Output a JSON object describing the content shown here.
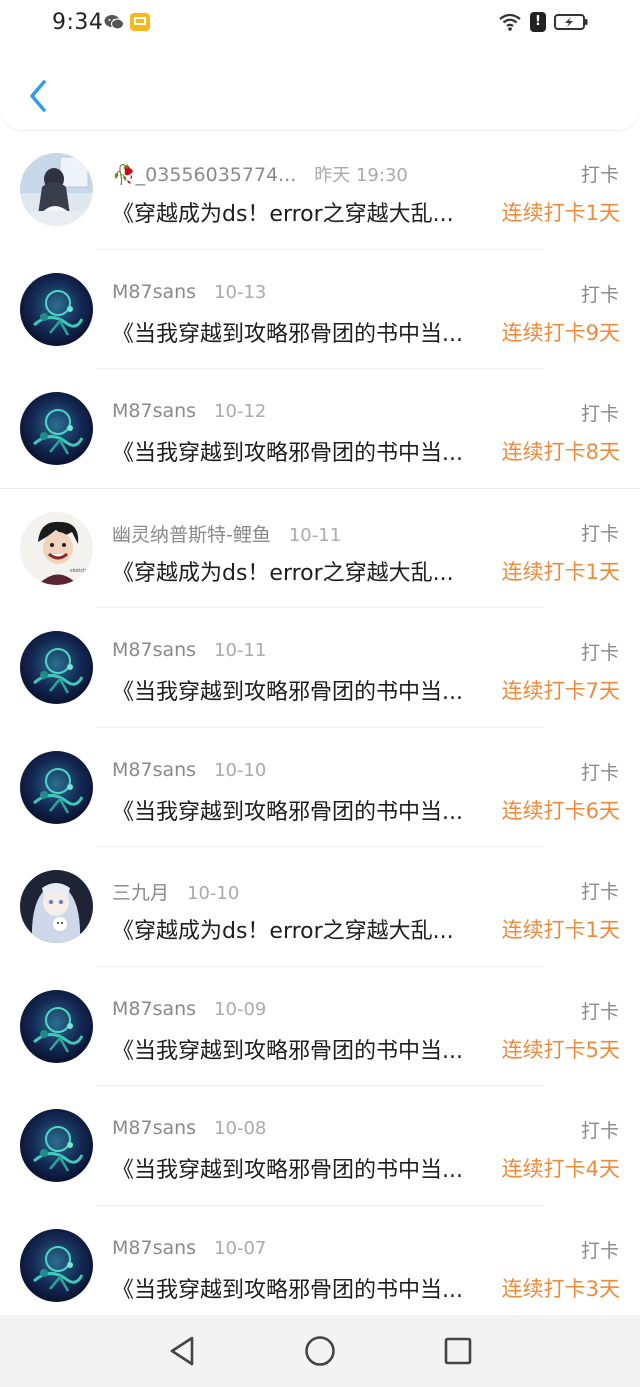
{
  "status_bar": {
    "time": "9:34",
    "left_icons": [
      "wechat-icon",
      "mail-notification-icon"
    ],
    "right_icons": [
      "wifi-icon",
      "alert-icon",
      "battery-charging-icon"
    ],
    "alert_glyph": "!"
  },
  "header": {
    "back_icon": "chevron-left-icon",
    "accent_color": "#2f9bf0"
  },
  "records": [
    {
      "username": "🥀_03556035774...",
      "date": "昨天 19:30",
      "type": "打卡",
      "title": "《穿越成为ds！error之穿越大乱...",
      "streak": "连续打卡1天",
      "avatar": "girl-window"
    },
    {
      "username": "M87sans",
      "date": "10-13",
      "type": "打卡",
      "title": "《当我穿越到攻略邪骨团的书中当...",
      "streak": "连续打卡9天",
      "avatar": "dark-blue"
    },
    {
      "username": "M87sans",
      "date": "10-12",
      "type": "打卡",
      "title": "《当我穿越到攻略邪骨团的书中当...",
      "streak": "连续打卡8天",
      "avatar": "dark-blue"
    },
    {
      "username": "幽灵纳普斯特-鲤鱼",
      "date": "10-11",
      "type": "打卡",
      "title": "《穿越成为ds！error之穿越大乱...",
      "streak": "连续打卡1天",
      "avatar": "sketch-boy"
    },
    {
      "username": "M87sans",
      "date": "10-11",
      "type": "打卡",
      "title": "《当我穿越到攻略邪骨团的书中当...",
      "streak": "连续打卡7天",
      "avatar": "dark-blue"
    },
    {
      "username": "M87sans",
      "date": "10-10",
      "type": "打卡",
      "title": "《当我穿越到攻略邪骨团的书中当...",
      "streak": "连续打卡6天",
      "avatar": "dark-blue"
    },
    {
      "username": "三九月",
      "date": "10-10",
      "type": "打卡",
      "title": "《穿越成为ds！error之穿越大乱...",
      "streak": "连续打卡1天",
      "avatar": "anime-girl"
    },
    {
      "username": "M87sans",
      "date": "10-09",
      "type": "打卡",
      "title": "《当我穿越到攻略邪骨团的书中当...",
      "streak": "连续打卡5天",
      "avatar": "dark-blue"
    },
    {
      "username": "M87sans",
      "date": "10-08",
      "type": "打卡",
      "title": "《当我穿越到攻略邪骨团的书中当...",
      "streak": "连续打卡4天",
      "avatar": "dark-blue"
    },
    {
      "username": "M87sans",
      "date": "10-07",
      "type": "打卡",
      "title": "《当我穿越到攻略邪骨团的书中当...",
      "streak": "连续打卡3天",
      "avatar": "dark-blue"
    }
  ],
  "colors": {
    "streak": "#f08a3a",
    "meta": "#8a8a8a",
    "title": "#1e1e1e",
    "back_arrow": "#2f9bf0"
  },
  "nav_bar": {
    "icons": [
      "back-triangle-icon",
      "home-circle-icon",
      "recents-square-icon"
    ]
  }
}
